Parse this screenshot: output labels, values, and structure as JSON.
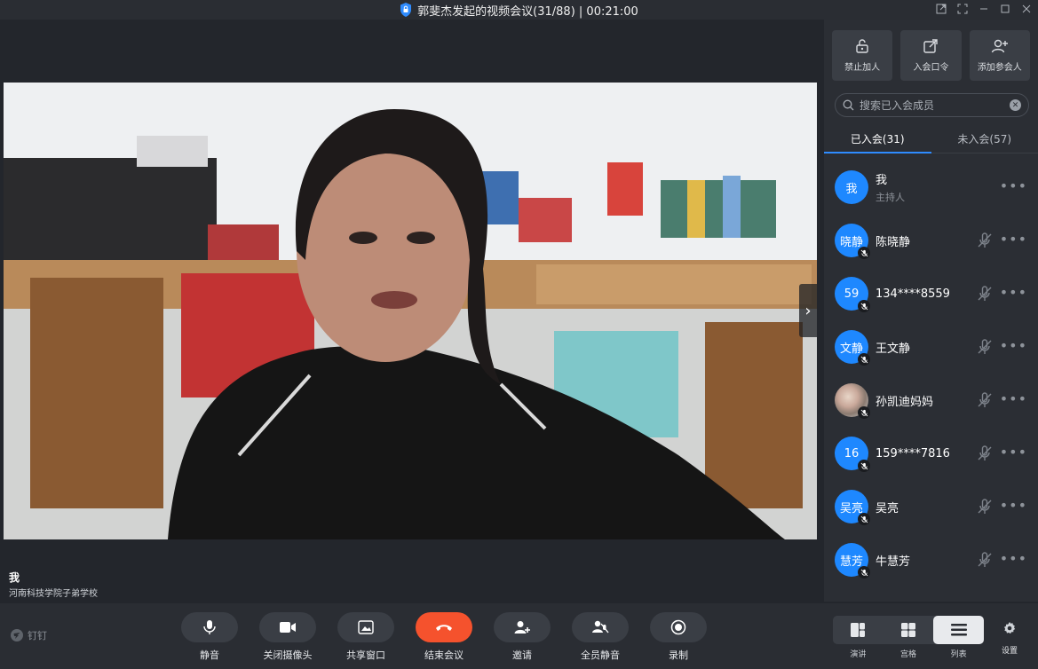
{
  "window": {
    "title": "郭斐杰发起的视频会议(31/88) | 00:21:00"
  },
  "stage": {
    "speaker_name": "我",
    "speaker_org": "河南科技学院子弟学校"
  },
  "sidebar": {
    "actions": [
      {
        "label": "禁止加人",
        "icon": "unlock-icon"
      },
      {
        "label": "入会口令",
        "icon": "share-external-icon"
      },
      {
        "label": "添加参会人",
        "icon": "add-user-icon"
      }
    ],
    "search_placeholder": "搜索已入会成员",
    "tabs": [
      {
        "label": "已入会(31)",
        "active": true
      },
      {
        "label": "未入会(57)",
        "active": false
      }
    ],
    "members": [
      {
        "avatar_text": "我",
        "name": "我",
        "role": "主持人",
        "muted": false
      },
      {
        "avatar_text": "晓静",
        "name": "陈晓静",
        "muted": true
      },
      {
        "avatar_text": "59",
        "name": "134****8559",
        "muted": true
      },
      {
        "avatar_text": "文静",
        "name": "王文静",
        "muted": true
      },
      {
        "avatar_text": "",
        "name": "孙凯迪妈妈",
        "muted": true,
        "photo": true
      },
      {
        "avatar_text": "16",
        "name": "159****7816",
        "muted": true
      },
      {
        "avatar_text": "吴亮",
        "name": "吴亮",
        "muted": true
      },
      {
        "avatar_text": "慧芳",
        "name": "牛慧芳",
        "muted": true
      }
    ]
  },
  "toolbar": {
    "brand": "钉钉",
    "buttons": [
      {
        "label": "静音",
        "icon": "microphone-icon"
      },
      {
        "label": "关闭摄像头",
        "icon": "camera-icon"
      },
      {
        "label": "共享窗口",
        "icon": "share-screen-icon"
      },
      {
        "label": "结束会议",
        "icon": "hangup-icon"
      },
      {
        "label": "邀请",
        "icon": "invite-icon"
      },
      {
        "label": "全员静音",
        "icon": "mute-all-icon"
      },
      {
        "label": "录制",
        "icon": "record-icon"
      }
    ],
    "layouts": [
      {
        "label": "演讲",
        "active": false
      },
      {
        "label": "宫格",
        "active": false
      },
      {
        "label": "列表",
        "active": true
      }
    ],
    "settings_label": "设置"
  },
  "colors": {
    "accent": "#2f8cff",
    "avatar_blue": "#1e88ff",
    "end_call_red": "#f5522d"
  }
}
